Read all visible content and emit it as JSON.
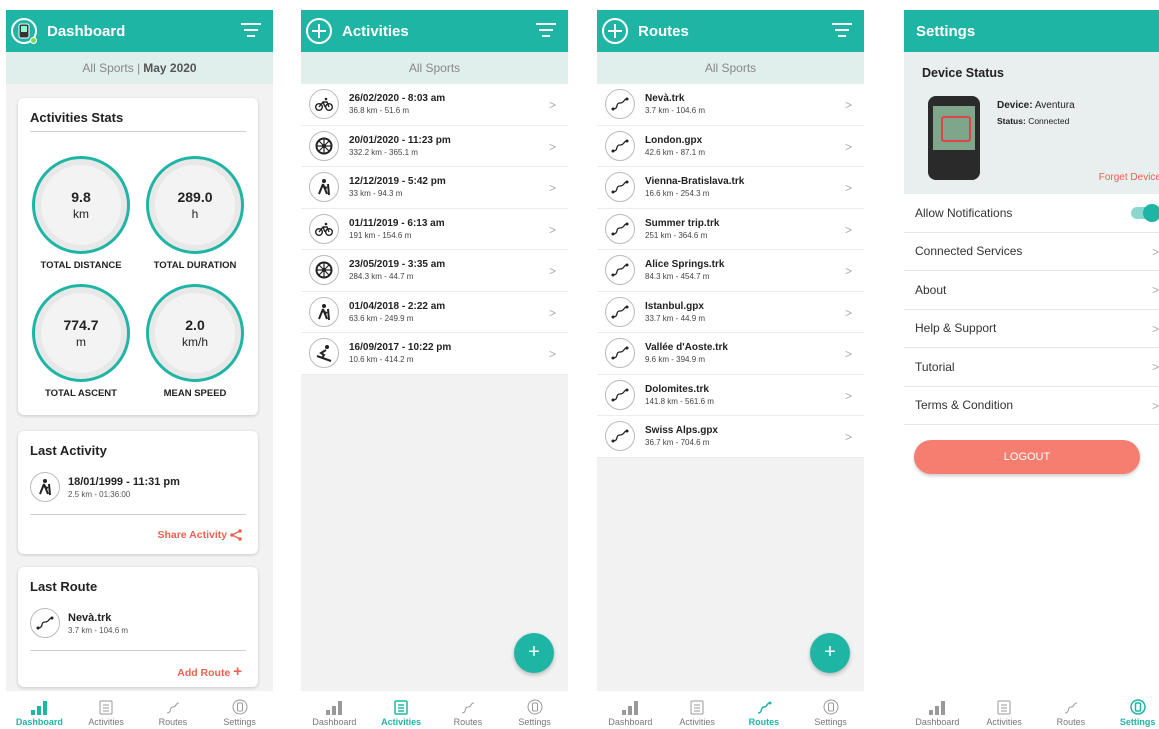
{
  "colors": {
    "accent": "#1fb5a5",
    "alert": "#f06050"
  },
  "nav": {
    "dashboard": "Dashboard",
    "activities": "Activities",
    "routes": "Routes",
    "settings": "Settings"
  },
  "dashboard": {
    "title": "Dashboard",
    "filter_label": "All Sports |",
    "filter_date": "May 2020",
    "stats_title": "Activities Stats",
    "stats": [
      {
        "value": "9.8",
        "unit": "km",
        "label": "TOTAL DISTANCE"
      },
      {
        "value": "289.0",
        "unit": "h",
        "label": "TOTAL DURATION"
      },
      {
        "value": "774.7",
        "unit": "m",
        "label": "TOTAL ASCENT"
      },
      {
        "value": "2.0",
        "unit": "km/h",
        "label": "MEAN SPEED"
      }
    ],
    "last_activity": {
      "title": "Last Activity",
      "date": "18/01/1999 - 11:31 pm",
      "details": "2.5 km - 01:36:00",
      "action": "Share Activity"
    },
    "last_route": {
      "title": "Last Route",
      "name": "Nevà.trk",
      "details": "3.7 km - 104.6 m",
      "action": "Add Route"
    }
  },
  "activities": {
    "title": "Activities",
    "filter": "All Sports",
    "items": [
      {
        "date": "26/02/2020 - 8:03 am",
        "details": "36.8 km - 51.6 m",
        "icon": "bike-icon"
      },
      {
        "date": "20/01/2020 - 11:23 pm",
        "details": "332.2 km - 365.1 m",
        "icon": "wheel-icon"
      },
      {
        "date": "12/12/2019 - 5:42 pm",
        "details": "33 km - 94.3 m",
        "icon": "hiker-icon"
      },
      {
        "date": "01/11/2019 - 6:13 am",
        "details": "191 km - 154.6 m",
        "icon": "bike-icon"
      },
      {
        "date": "23/05/2019 - 3:35 am",
        "details": "284.3 km - 44.7 m",
        "icon": "wheel-icon"
      },
      {
        "date": "01/04/2018 - 2:22 am",
        "details": "63.6 km - 249.9 m",
        "icon": "hiker-icon"
      },
      {
        "date": "16/09/2017 - 10:22 pm",
        "details": "10.6 km - 414.2 m",
        "icon": "skier-icon"
      }
    ],
    "fab": "+"
  },
  "routes": {
    "title": "Routes",
    "filter": "All Sports",
    "items": [
      {
        "name": "Nevà.trk",
        "details": "3.7 km - 104.6 m"
      },
      {
        "name": "London.gpx",
        "details": "42.6 km - 87.1 m"
      },
      {
        "name": "Vienna-Bratislava.trk",
        "details": "16.6 km - 254.3 m"
      },
      {
        "name": "Summer trip.trk",
        "details": "251 km - 364.6 m"
      },
      {
        "name": "Alice Springs.trk",
        "details": "84.3 km - 454.7 m"
      },
      {
        "name": "Istanbul.gpx",
        "details": "33.7 km - 44.9 m"
      },
      {
        "name": "Vallée d'Aoste.trk",
        "details": "9.6 km - 394.9 m"
      },
      {
        "name": "Dolomites.trk",
        "details": "141.8 km - 561.6 m"
      },
      {
        "name": "Swiss Alps.gpx",
        "details": "36.7 km - 704.6 m"
      }
    ],
    "fab": "+"
  },
  "settings": {
    "title": "Settings",
    "device_status": "Device Status",
    "device_label": "Device:",
    "device_value": "Aventura",
    "status_label": "Status:",
    "status_value": "Connected",
    "forget": "Forget Device",
    "rows": [
      "Allow Notifications",
      "Connected Services",
      "About",
      "Help & Support",
      "Tutorial",
      "Terms & Condition"
    ],
    "notifications_on": true,
    "logout": "LOGOUT"
  }
}
